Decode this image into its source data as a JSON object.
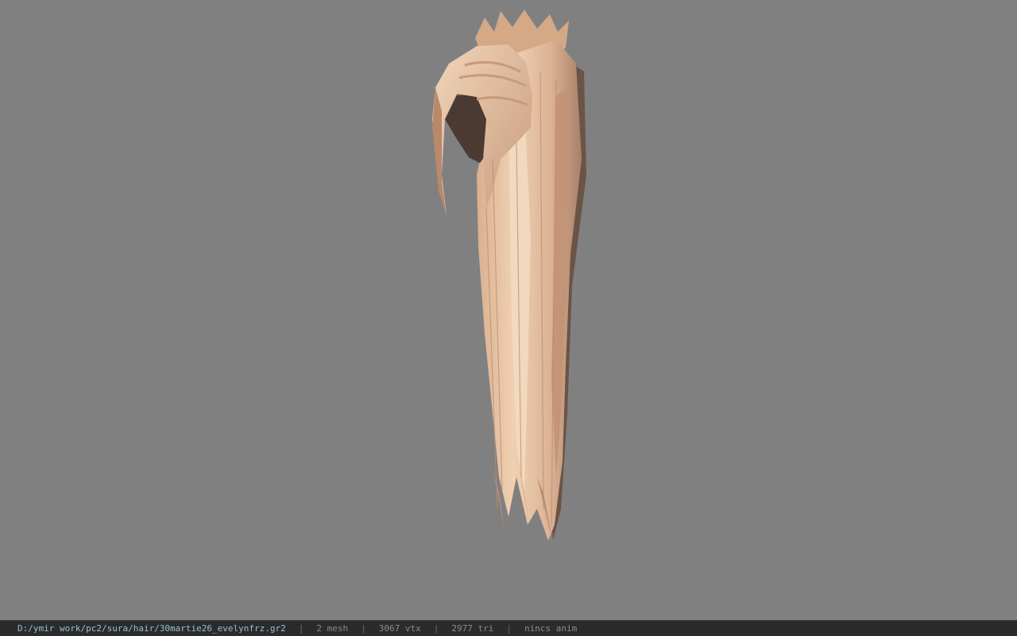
{
  "viewer": {
    "background_color": "#808080",
    "model": {
      "icon": "hair-mesh-render",
      "colors": {
        "light": "#e8c4a2",
        "mid": "#cfa384",
        "shadow": "#9c7660",
        "dark": "#4a3a32"
      }
    }
  },
  "statusbar": {
    "file_path": "D:/ymir work/pc2/sura/hair/30martie26_evelynfrz.gr2",
    "separator": "|",
    "mesh_count": "2 mesh",
    "vertex_count": "3067 vtx",
    "triangle_count": "2977 tri",
    "anim_status": "nincs anim",
    "path_color": "#8fc4d4",
    "text_color": "#8c8c8c"
  }
}
